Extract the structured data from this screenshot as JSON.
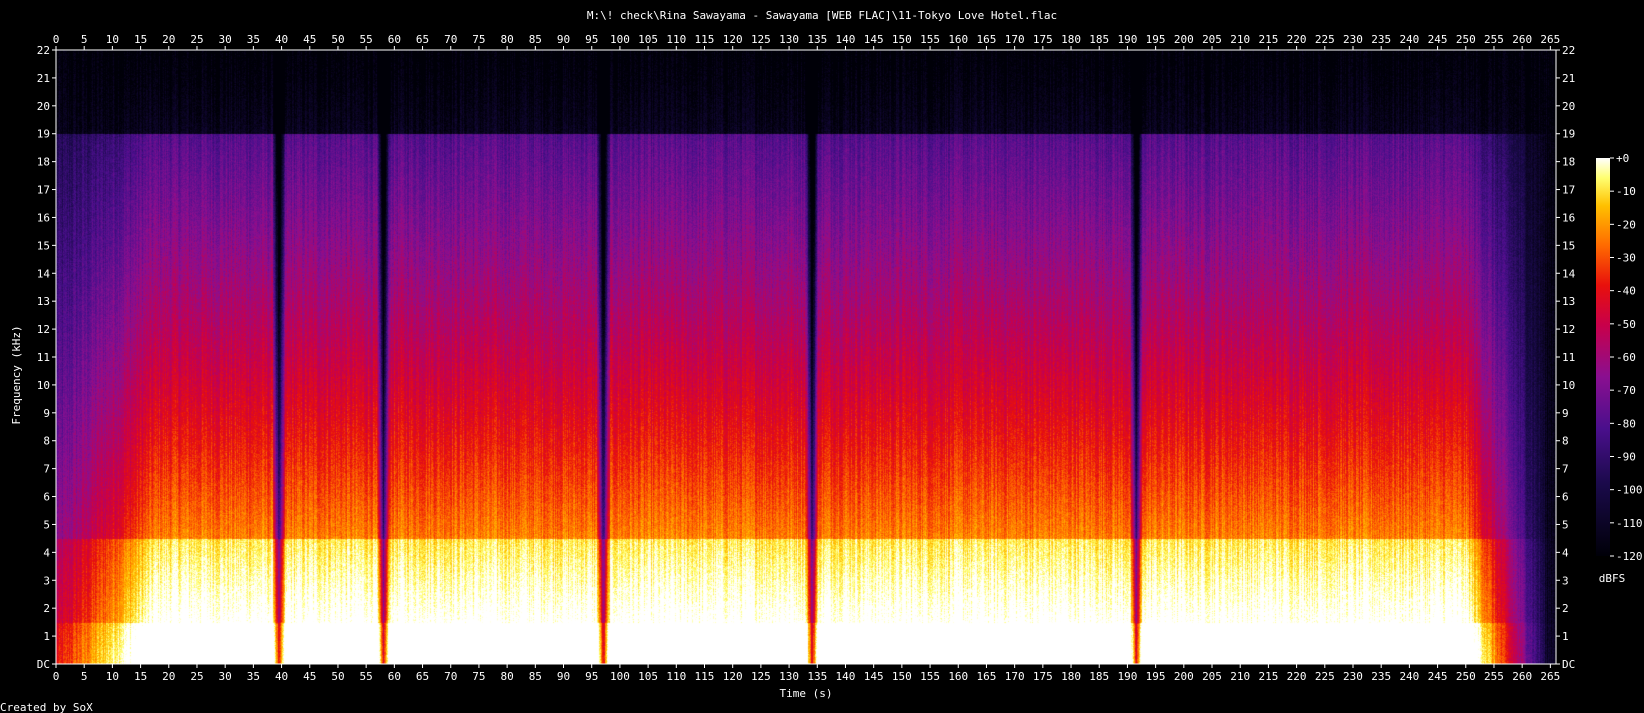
{
  "chart_data": {
    "type": "heatmap",
    "title": "M:\\! check\\Rina Sawayama - Sawayama [WEB FLAC]\\11-Tokyo Love Hotel.flac",
    "xlabel": "Time (s)",
    "ylabel": "Frequency (kHz)",
    "xlim": [
      0,
      266
    ],
    "ylim": [
      0,
      22
    ],
    "x_ticks": [
      0,
      5,
      10,
      15,
      20,
      25,
      30,
      35,
      40,
      45,
      50,
      55,
      60,
      65,
      70,
      75,
      80,
      85,
      90,
      95,
      100,
      105,
      110,
      115,
      120,
      125,
      130,
      135,
      140,
      145,
      150,
      155,
      160,
      165,
      170,
      175,
      180,
      185,
      190,
      195,
      200,
      205,
      210,
      215,
      220,
      225,
      230,
      235,
      240,
      245,
      250,
      255,
      260,
      265
    ],
    "y_tick_labels": [
      "DC",
      "1",
      "2",
      "3",
      "4",
      "5",
      "6",
      "7",
      "8",
      "9",
      "10",
      "11",
      "12",
      "13",
      "14",
      "15",
      "16",
      "17",
      "18",
      "19",
      "20",
      "21",
      "22"
    ],
    "colorbar": {
      "label": "dBFS",
      "ticks": [
        "+0",
        "-10",
        "-20",
        "-30",
        "-40",
        "-50",
        "-60",
        "-70",
        "-80",
        "-90",
        "-100",
        "-110",
        "-120"
      ],
      "range": [
        -120,
        0
      ]
    },
    "dips_s": [
      39.5,
      58,
      97,
      134,
      191.5
    ],
    "fade_in_s": [
      0,
      18
    ],
    "fade_out_s": [
      250,
      264
    ],
    "lowpass_cutoff_khz": 19,
    "footer": "Created by SoX",
    "colors": {
      "bg": "#000000",
      "low": "#000010",
      "mid_low": "#4a0f8c",
      "mid": "#e0001f",
      "mid_high": "#ff9a00",
      "high": "#ffff9a",
      "max": "#ffffff"
    }
  }
}
